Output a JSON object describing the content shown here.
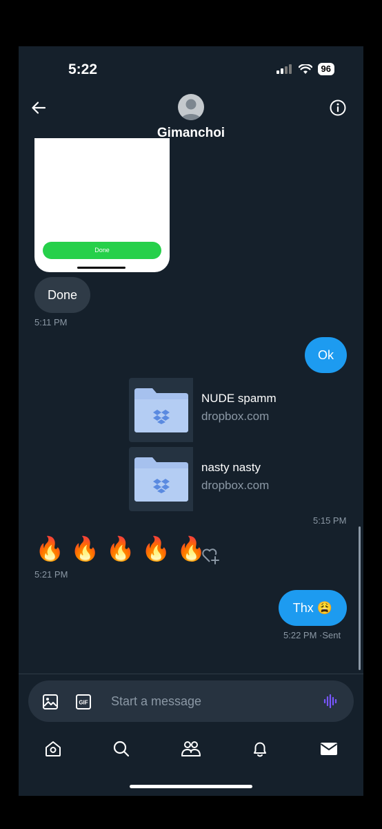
{
  "status_bar": {
    "time": "5:22",
    "battery": "96"
  },
  "header": {
    "name": "Gimanchoi"
  },
  "media": {
    "button_label": "Done"
  },
  "messages": {
    "done_text": "Done",
    "done_time": "5:11 PM",
    "ok_text": "Ok",
    "links": [
      {
        "title": "NUDE spamm",
        "domain": "dropbox.com"
      },
      {
        "title": "nasty nasty",
        "domain": "dropbox.com"
      }
    ],
    "links_time": "5:15 PM",
    "fire_emojis": [
      "🔥",
      "🔥",
      "🔥",
      "🔥",
      "🔥"
    ],
    "fire_time": "5:21 PM",
    "thx_text": "Thx 😩",
    "thx_time": "5:22 PM",
    "thx_status": "·Sent"
  },
  "composer": {
    "placeholder": "Start a message"
  },
  "colors": {
    "background": "#15202b",
    "accent": "#1d9bf0",
    "incoming": "#2f3b47",
    "voice": "#7856ff"
  },
  "icons": [
    "back-arrow-icon",
    "info-icon",
    "image-icon",
    "gif-icon",
    "voice-icon",
    "home-icon",
    "search-icon",
    "communities-icon",
    "notifications-icon",
    "messages-icon",
    "heart-plus-icon",
    "dropbox-icon"
  ]
}
